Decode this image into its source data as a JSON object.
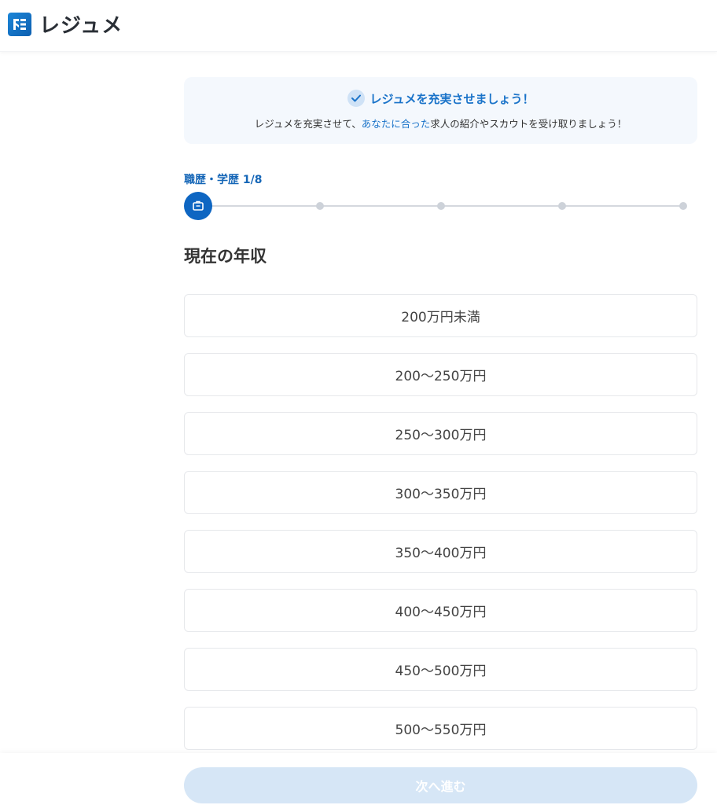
{
  "header": {
    "logo_text": "レジュメ",
    "logo_icon": "resume-logo-icon"
  },
  "banner": {
    "title": "レジュメを充実させましょう！",
    "desc_before": "レジュメを充実させて、",
    "desc_accent": "あなたに合った",
    "desc_after": "求人の紹介やスカウトを受け取りましょう！",
    "accent_color": "#1a73c9"
  },
  "step": {
    "label": "職歴・学歴 1/8",
    "current_icon": "briefcase-icon",
    "total_dots": 5,
    "current_index": 1
  },
  "question": {
    "title": "現在の年収"
  },
  "options": [
    {
      "label": "200万円未満"
    },
    {
      "label": "200〜250万円"
    },
    {
      "label": "250〜300万円"
    },
    {
      "label": "300〜350万円"
    },
    {
      "label": "350〜400万円"
    },
    {
      "label": "400〜450万円"
    },
    {
      "label": "450〜500万円"
    },
    {
      "label": "500〜550万円"
    }
  ],
  "footer": {
    "next_label": "次へ進む",
    "next_disabled": true
  },
  "colors": {
    "primary": "#0e66c2",
    "disabled_button": "#d6e6f6"
  }
}
